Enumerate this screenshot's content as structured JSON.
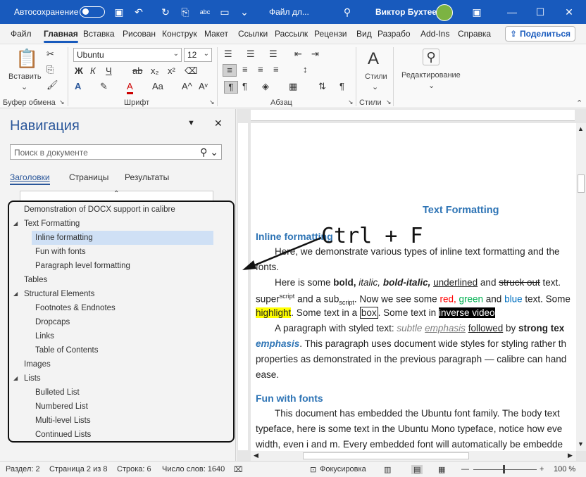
{
  "titlebar": {
    "autosave_label": "Автосохранение",
    "filename": "Файл дл...",
    "user": "Виктор Бухтеев",
    "abc_icon_text": "abc"
  },
  "menu": {
    "tabs": [
      "Файл",
      "Главная",
      "Вставка",
      "Рисован",
      "Конструк",
      "Макет",
      "Ссылки",
      "Рассылк",
      "Рецензи",
      "Вид",
      "Разрабо",
      "Add-Ins",
      "Справка"
    ],
    "share": "Поделиться"
  },
  "ribbon": {
    "paste": "Вставить",
    "clipboard": "Буфер обмена",
    "font_name": "Ubuntu",
    "font_size": "12",
    "font_group": "Шрифт",
    "paragraph_group": "Абзац",
    "styles": "Стили",
    "styles_group": "Стили",
    "editing": "Редактирование",
    "bold": "Ж",
    "italic": "К",
    "underline": "Ч",
    "strike": "ab",
    "subscript": "x₂",
    "superscript": "x²",
    "font_color": "A",
    "grow": "A^",
    "shrink": "Aᵛ",
    "case": "Aa",
    "aA": "A"
  },
  "nav": {
    "title": "Навигация",
    "search_placeholder": "Поиск в документе",
    "tabs": [
      "Заголовки",
      "Страницы",
      "Результаты"
    ],
    "items": [
      "Demonstration of DOCX support in calibre",
      "Text Formatting",
      "Inline formatting",
      "Fun with fonts",
      "Paragraph level formatting",
      "Tables",
      "Structural Elements",
      "Footnotes & Endnotes",
      "Dropcaps",
      "Links",
      "Table of Contents",
      "Images",
      "Lists",
      "Bulleted List",
      "Numbered List",
      "Multi-level Lists",
      "Continued Lists"
    ]
  },
  "document": {
    "heading_main": "Text Formatting",
    "heading_inline": "Inline formatting",
    "p1a": "Here, we demonstrate various types of inline text formatting and the",
    "p1b": "fonts.",
    "p2a_pre": "Here is some ",
    "p2a_bold": "bold,",
    "p2a_italic": "italic,",
    "p2a_bi": "bold-italic,",
    "p2a_ul": "underlined",
    "p2a_and": "and",
    "p2a_strike": "struck out",
    "p2a_text": "text.",
    "p2b_super": "super",
    "p2b_script": "script",
    "p2b_and": "and a sub",
    "p2b_subscript": "script",
    "p2b_see": ". Now we see some",
    "p2b_red": "red,",
    "p2b_green": "green",
    "p2b_andb": "and",
    "p2b_blue": "blue",
    "p2b_text": "text. Some",
    "p2c_highlight": "highlight",
    "p2c_mid": ". Some text in a",
    "p2c_box": "box",
    "p2c_mid2": ". Some text in",
    "p2c_inverse": "inverse video",
    "p3a_pre": "A paragraph with styled text:",
    "p3a_subtle": "subtle",
    "p3a_emph": "emphasis",
    "p3a_followed": "followed",
    "p3a_by": "by",
    "p3a_strong": "strong tex",
    "p3b_emph": "emphasis",
    "p3b_rest": ". This paragraph uses document wide styles for styling rather th",
    "p3c": "properties as demonstrated in the previous paragraph — calibre can hand",
    "p3d": "ease.",
    "heading_fonts": "Fun with fonts",
    "p4a": "This document has embedded the Ubuntu font family. The body text",
    "p4b": "typeface, here is some text in the Ubuntu Mono typeface, notice how eve",
    "p4c": "width, even i and m. Every embedded font will automatically be embedde"
  },
  "overlay_text": "Ctrl + F",
  "statusbar": {
    "section": "Раздел: 2",
    "page": "Страница 2 из 8",
    "line": "Строка: 6",
    "words": "Число слов: 1640",
    "focus": "Фокусировка",
    "zoom": "100 %"
  },
  "colors": {
    "brand": "#185abd",
    "heading": "#2e74b5",
    "highlight": "#ffff00",
    "red": "#ff0000",
    "green": "#00b050",
    "blue": "#0070c0"
  }
}
